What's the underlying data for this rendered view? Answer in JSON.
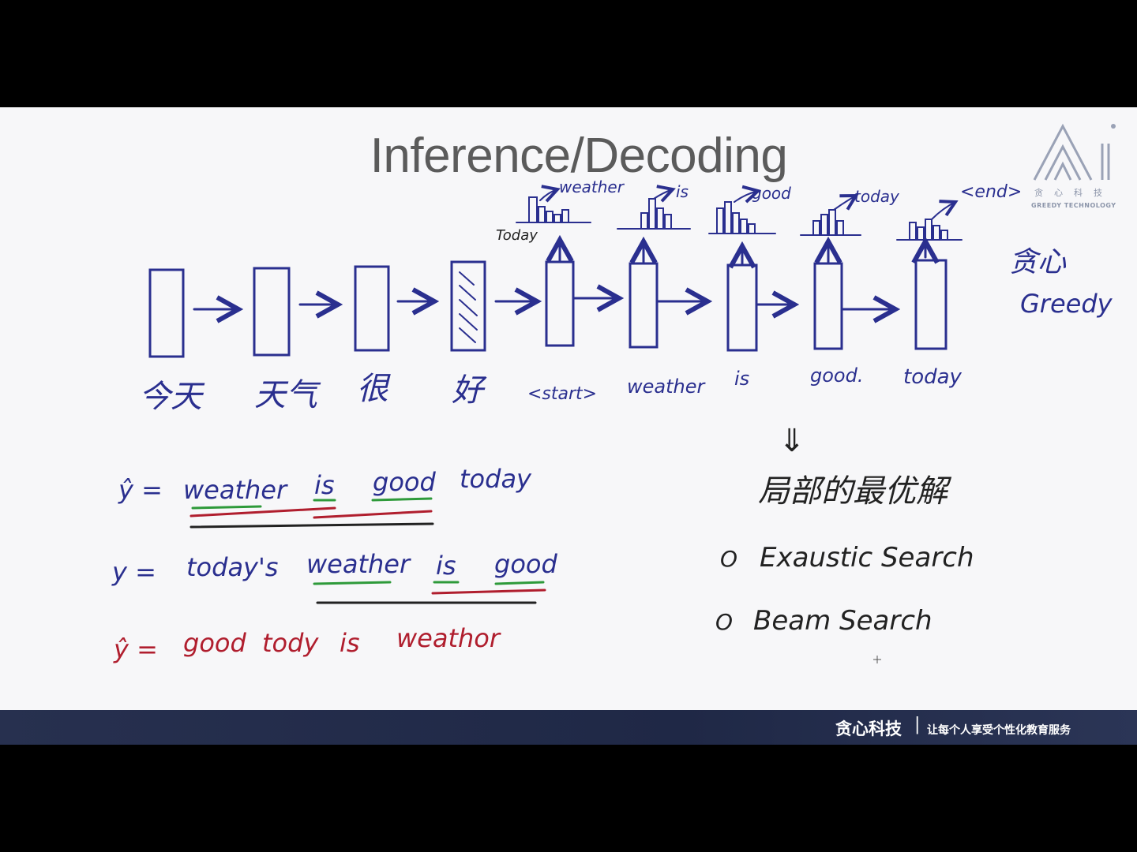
{
  "title": "Inference/Decoding",
  "logo": {
    "chinese": "贪心科技",
    "english": "GREEDY TECHNOLOGY"
  },
  "footer": {
    "company": "贪心科技",
    "separator": "|",
    "slogan": "让每个人享受个性化教育服务"
  },
  "encoder_tokens": [
    "今天",
    "天气",
    "很",
    "好"
  ],
  "decoder_inputs": [
    "<start>",
    "weather",
    "is",
    "good.",
    "today"
  ],
  "decoder_outputs": [
    "weather",
    "is",
    "good",
    "today",
    "<end>"
  ],
  "side_label": "Today",
  "greedy": {
    "chinese": "贪心",
    "english": "Greedy"
  },
  "arrow_down": "⇓",
  "local_optimum": "局部的最优解",
  "bullets": [
    "Exaustic Search",
    "Beam Search"
  ],
  "bullet_marker": "O",
  "equations": {
    "line1": {
      "lhs": "ŷ =",
      "words": [
        "weather",
        "is",
        "good",
        "today"
      ]
    },
    "line2": {
      "lhs": "y =",
      "words": [
        "today's",
        "weather",
        "is",
        "good"
      ]
    },
    "line3": {
      "lhs": "ŷ =",
      "words": [
        "good",
        "tody",
        "is",
        "weathor"
      ]
    }
  },
  "colors": {
    "ink_blue": "#2a2f8f",
    "ink_red": "#b01e2e",
    "ink_green": "#2e9a3a",
    "ink_black": "#222222",
    "title_gray": "#5b5b5b",
    "footer_navy": "#25304f"
  }
}
